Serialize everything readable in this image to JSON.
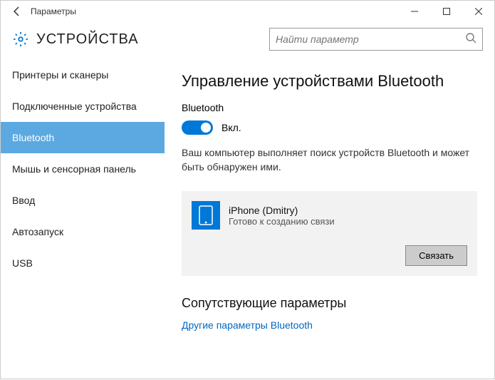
{
  "window": {
    "title": "Параметры"
  },
  "header": {
    "title": "УСТРОЙСТВА"
  },
  "search": {
    "placeholder": "Найти параметр"
  },
  "sidebar": {
    "items": [
      {
        "label": "Принтеры и сканеры",
        "selected": false
      },
      {
        "label": "Подключенные устройства",
        "selected": false
      },
      {
        "label": "Bluetooth",
        "selected": true
      },
      {
        "label": "Мышь и сенсорная панель",
        "selected": false
      },
      {
        "label": "Ввод",
        "selected": false
      },
      {
        "label": "Автозапуск",
        "selected": false
      },
      {
        "label": "USB",
        "selected": false
      }
    ]
  },
  "main": {
    "title": "Управление устройствами Bluetooth",
    "toggle_label": "Bluetooth",
    "toggle_state": "Вкл.",
    "description": "Ваш компьютер выполняет поиск устройств Bluetooth и может быть обнаружен ими.",
    "device": {
      "name": "iPhone (Dmitry)",
      "status": "Готово к созданию связи",
      "connect_label": "Связать"
    },
    "related_title": "Сопутствующие параметры",
    "related_link": "Другие параметры Bluetooth"
  }
}
